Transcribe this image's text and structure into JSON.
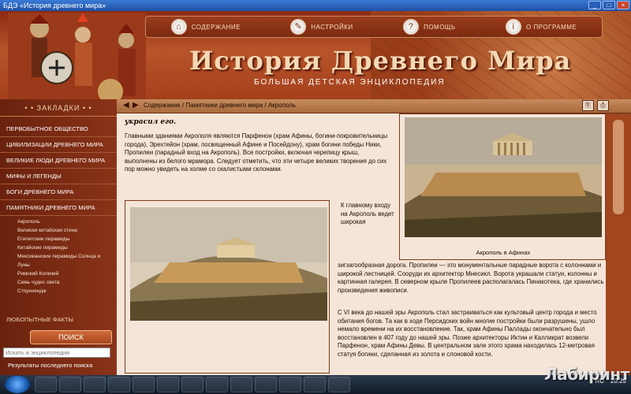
{
  "window": {
    "title": "БДЭ «История древнего мира»",
    "buttons": [
      "_",
      "□",
      "×"
    ]
  },
  "menu": [
    {
      "label": "СОДЕРЖАНИЕ",
      "icon": "home-icon"
    },
    {
      "label": "НАСТРОЙКИ",
      "icon": "wrench-icon"
    },
    {
      "label": "ПОМОЩЬ",
      "icon": "help-icon"
    },
    {
      "label": "О ПРОГРАММЕ",
      "icon": "info-icon"
    }
  ],
  "header": {
    "title": "История Древнего Мира",
    "subtitle": "БОЛЬШАЯ ДЕТСКАЯ ЭНЦИКЛОПЕДИЯ"
  },
  "sidebar": {
    "header": "• • ЗАКЛАДКИ • •",
    "items": [
      "ПЕРВОБЫТНОЕ ОБЩЕСТВО",
      "ЦИВИЛИЗАЦИИ ДРЕВНЕГО МИРА",
      "ВЕЛИКИЕ ЛЮДИ ДРЕВНЕГО МИРА",
      "МИФЫ И ЛЕГЕНДЫ",
      "БОГИ ДРЕВНЕГО МИРА",
      "ПАМЯТНИКИ ДРЕВНЕГО МИРА"
    ],
    "subitems": [
      "Акрополь",
      "Великая китайская стена",
      "Египетские пирамиды",
      "Китайские пирамиды",
      "Мексиканские пирамиды Солнца и",
      "Луны",
      "Римский Колизей",
      "Семь чудес света",
      "Стоунхендж"
    ],
    "more": "ЛЮБОПЫТНЫЕ ФАКТЫ",
    "search_button": "ПОИСК",
    "search_placeholder": "Искать в энциклопедии",
    "last_results": "Результаты последнего поиска"
  },
  "breadcrumb": {
    "back": "◀",
    "forward": "▶",
    "path": "Содержание / Памятники древнего мира / Акрополь"
  },
  "article": {
    "lead": "украсил его.",
    "para1": "Главными зданиями Акрополя являются Парфенон (храм Афины, богини-покровительницы города), Эрехтейон (храм, посвященный Афине и Посейдону), храм богини победы Ники, Пропилеи (парадный вход на Акрополь). Все постройки, включая черепицу крыш, выполнены из белого мрамора. Следует отметить, что эти четыре великих творения до сих пор можно увидеть на холме со скалистыми склонами.",
    "beside": "К главному входу на Акрополь ведет широкая",
    "para2": "зигзагообразная дорога. Пропилеи — это монументальные парадные ворота с колоннами и широкой лестницей. Сооруди их архитектор Мнесикл. Ворота украшали статуи, колонны и картинная галерея. В северном крыле Пропилеев располагалась Пинакотека, где хранились произведения живописи.",
    "para3": "С VI века до нашей эры Акрополь стал застраиваться как культовый центр города и место обитания богов. Та как в ходе Персидских войн многие постройки были разрушены, ушло немало времени на их восстановление. Так, храм Афины Паллады окончательно был восстановлен в 407 году до нашей эры. Позже архитекторы Иктин и Калликрат возвели Парфенон, храм Афины Девы. В центральном зале этого храма находилась 12-метровая статуя богини, сделанная из золота и слоновой кости.",
    "caption_right": "Акрополь в Афинах"
  },
  "taskbar": {
    "lang": "RU",
    "time": "20:29"
  },
  "watermark": "Лабиринт"
}
